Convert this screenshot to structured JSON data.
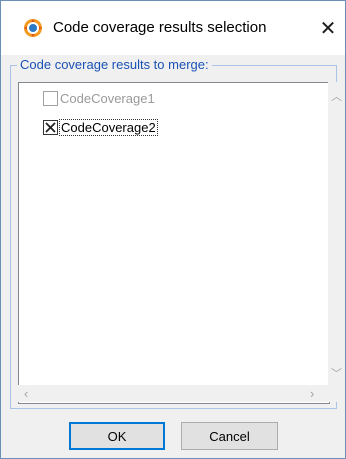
{
  "window": {
    "title": "Code coverage results selection",
    "close_label": "✕"
  },
  "group": {
    "label": "Code coverage results to merge:"
  },
  "items": [
    {
      "label": "CodeCoverage1",
      "checked": false,
      "enabled": false
    },
    {
      "label": "CodeCoverage2",
      "checked": true,
      "enabled": true
    }
  ],
  "buttons": {
    "ok": "OK",
    "cancel": "Cancel"
  },
  "colors": {
    "group_label": "#1a51b5",
    "window_border": "#6b8fb5",
    "default_button_border": "#0078d7"
  }
}
